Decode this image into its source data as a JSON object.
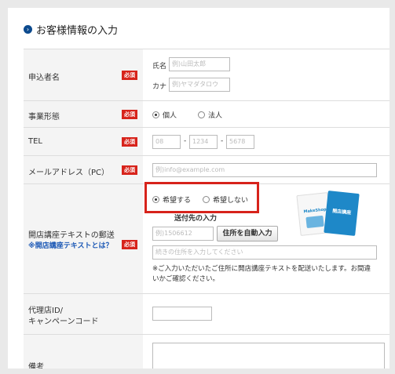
{
  "section": {
    "title": "お客様情報の入力",
    "icon": "chevron-right-icon"
  },
  "required_badge": "必須",
  "rows": {
    "name": {
      "label": "申込者名",
      "last_label": "氏名",
      "last_placeholder": "例)山田太郎",
      "kana_label": "カナ",
      "kana_placeholder": "例)ヤマダタロウ"
    },
    "business": {
      "label": "事業形態",
      "options": [
        {
          "label": "個人",
          "checked": true
        },
        {
          "label": "法人",
          "checked": false
        }
      ]
    },
    "tel": {
      "label": "TEL",
      "parts": [
        "08",
        "1234",
        "5678"
      ],
      "separator": "-"
    },
    "email": {
      "label": "メールアドレス（PC）",
      "placeholder": "例)info@example.com"
    },
    "textbook": {
      "label": "開店講座テキストの郵送",
      "link": "※開店講座テキストとは？",
      "options": [
        {
          "label": "希望する",
          "checked": true
        },
        {
          "label": "希望しない",
          "checked": false
        }
      ],
      "address_heading": "送付先の入力",
      "zip_placeholder": "例)1506612",
      "auto_button": "住所を自動入力",
      "address_placeholder": "続きの住所を入力してください",
      "note_line1": "※ご入力いただいたご住所に開店講座テキストを配送いたします。お間違",
      "note_line2": "いかご確認ください。",
      "book_label_1": "MakeShop",
      "book_label_2": "開店講座"
    },
    "agency": {
      "label_line1": "代理店ID/",
      "label_line2": "キャンペーンコード"
    },
    "remarks": {
      "label": "備考"
    }
  },
  "colors": {
    "required": "#d7231b",
    "highlight": "#d7231b",
    "link": "#1a57b5",
    "title_icon": "#0c4a8e"
  }
}
